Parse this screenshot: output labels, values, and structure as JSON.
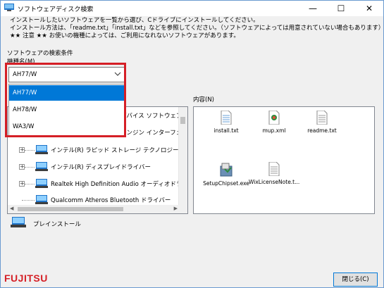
{
  "window": {
    "title": "ソフトウェアディスク検索",
    "minimize_glyph": "—",
    "maximize_glyph": "☐",
    "close_glyph": "✕"
  },
  "info": {
    "line1": "インストールしたいソフトウェアを一覧から選び、Cドライブにインストールしてください。",
    "line2": "インストール方法は、「readme.txt」「install.txt」などを参照してください。（ソフトウェアによっては用意されていない場合もあります）",
    "line3": "★★ 注意 ★★ お使いの機種によっては、ご利用になれないソフトウェアがあります。"
  },
  "search": {
    "section_label": "ソフトウェアの検索条件",
    "model_label": "機種名(M)",
    "selected_model": "AH77/W",
    "options": [
      "AH77/W",
      "AH78/W",
      "WA3/W"
    ],
    "selected_index": 0
  },
  "tree": {
    "items": [
      {
        "label": "デバイス ソフトウェア",
        "expander": "",
        "row": "partial"
      },
      {
        "label": "エンジン インターフェイ",
        "expander": "",
        "row": "partial"
      },
      {
        "label": "インテル(R) ラピッド ストレージ テクノロジー",
        "expander": "+"
      },
      {
        "label": "インテル(R) ディスプレイドライバー",
        "expander": "+"
      },
      {
        "label": "Realtek High Definition Audio オーディオドライバ",
        "expander": "+"
      },
      {
        "label": "Qualcomm Atheros Bluetooth ドライバー",
        "expander": ""
      }
    ]
  },
  "contents": {
    "label": "内容(N)",
    "files": [
      {
        "name": "install.txt",
        "icon": "text-file-icon"
      },
      {
        "name": "mup.xml",
        "icon": "xml-file-icon"
      },
      {
        "name": "readme.txt",
        "icon": "text-file-icon"
      },
      {
        "name": "SetupChipset.exe",
        "icon": "installer-icon"
      },
      {
        "name": "WixLicenseNote.t...",
        "icon": "text-file-icon"
      }
    ]
  },
  "preinstall_label": "プレインストール",
  "close_button": "閉じる(C)",
  "brand": "FUJITSU",
  "colors": {
    "highlight": "#d51f26",
    "selection": "#0078d7",
    "brand": "#d51f26"
  }
}
